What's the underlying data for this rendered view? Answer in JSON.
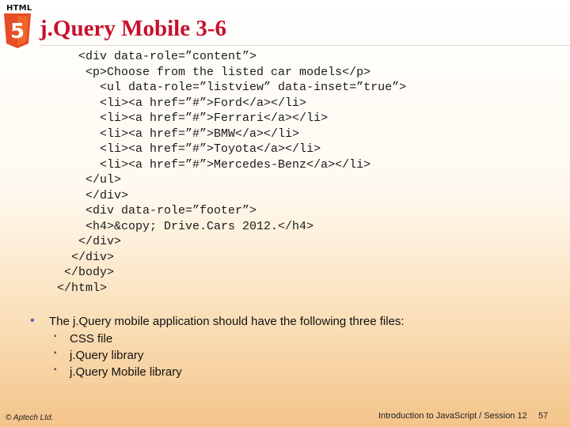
{
  "header": {
    "logo_text": "HTML",
    "logo_number": "5",
    "title": "j.Query Mobile 3-6"
  },
  "code_lines": [
    "           <div data-role=”content”>",
    "            <p>Choose from the listed car models</p>",
    "              <ul data-role=”listview” data-inset=”true”>",
    "              <li><a href=”#”>Ford</a></li>",
    "              <li><a href=”#”>Ferrari</a></li>",
    "              <li><a href=”#”>BMW</a></li>",
    "              <li><a href=”#”>Toyota</a></li>",
    "              <li><a href=”#”>Mercedes-Benz</a></li>",
    "            </ul>",
    "            </div>",
    "            <div data-role=”footer”>",
    "            <h4>&copy; Drive.Cars 2012.</h4>",
    "           </div>",
    "          </div>",
    "         </body>",
    "        </html>"
  ],
  "bullets": {
    "main": "The j.Query mobile application should have the following three files:",
    "sub": [
      "CSS file",
      "j.Query library",
      "j.Query Mobile library"
    ]
  },
  "footer": {
    "copyright": "© Aptech Ltd.",
    "course": "Introduction to JavaScript / Session 12",
    "page": "57"
  },
  "colors": {
    "title": "#c8102e",
    "shield": "#e44d26",
    "shield_light": "#f16529",
    "bullet": "#4a66a8"
  }
}
